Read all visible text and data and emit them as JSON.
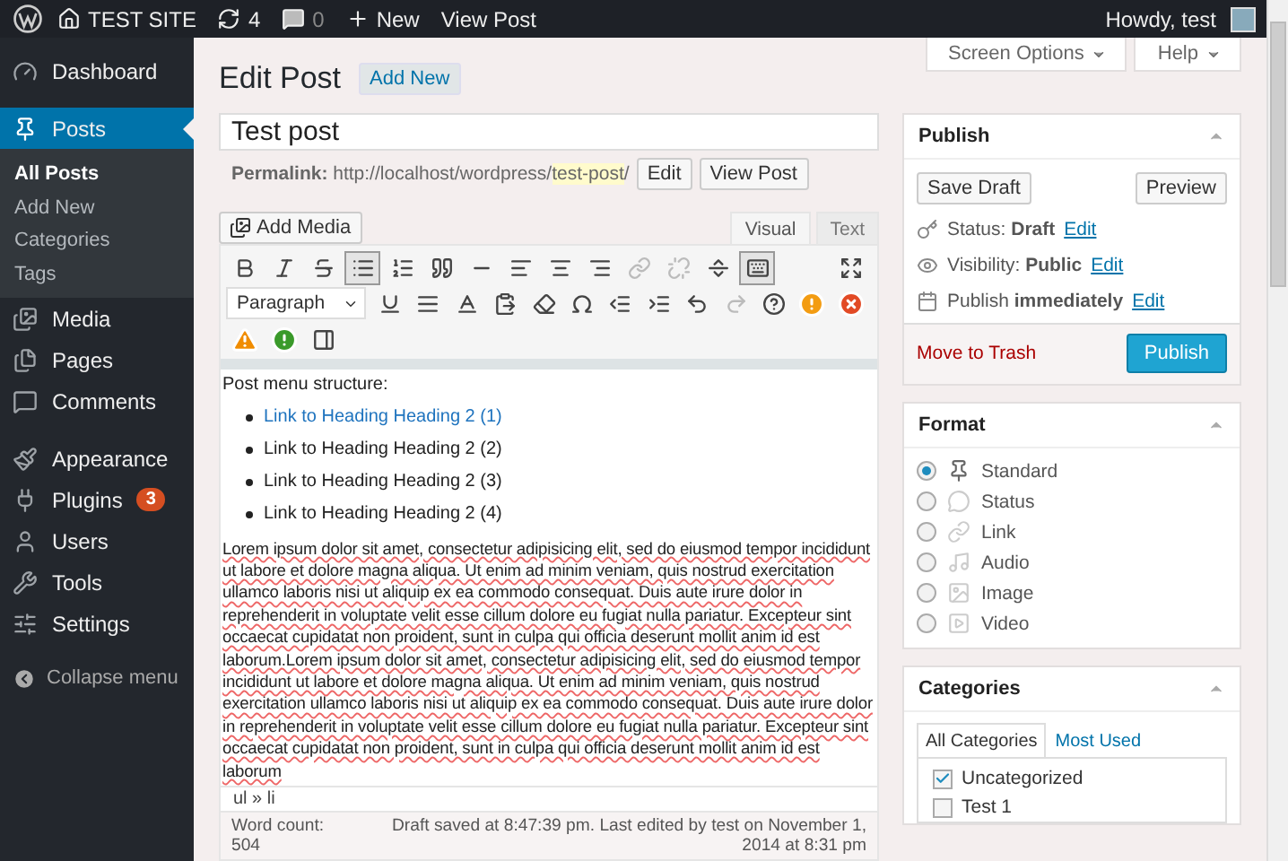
{
  "admin_bar": {
    "site_name": "TEST SITE",
    "updates_count": "4",
    "comments_count": "0",
    "new_label": "New",
    "view_post": "View Post",
    "greeting": "Howdy, test"
  },
  "sidebar": {
    "groups": [
      [
        {
          "kind": "dashboard",
          "label": "Dashboard",
          "selected": false
        }
      ],
      [
        {
          "kind": "posts",
          "label": "Posts",
          "selected": true,
          "expanded": true,
          "children": [
            {
              "label": "All Posts",
              "selected": true
            },
            {
              "label": "Add New",
              "selected": false
            },
            {
              "label": "Categories",
              "selected": false
            },
            {
              "label": "Tags",
              "selected": false
            }
          ]
        },
        {
          "kind": "media",
          "label": "Media",
          "selected": false
        },
        {
          "kind": "pages",
          "label": "Pages",
          "selected": false
        },
        {
          "kind": "comments",
          "label": "Comments",
          "selected": false
        }
      ],
      [
        {
          "kind": "appearance",
          "label": "Appearance",
          "selected": false
        },
        {
          "kind": "plugins",
          "label": "Plugins",
          "selected": false,
          "badge": "3"
        },
        {
          "kind": "users",
          "label": "Users",
          "selected": false
        },
        {
          "kind": "tools",
          "label": "Tools",
          "selected": false
        },
        {
          "kind": "settings",
          "label": "Settings",
          "selected": false
        }
      ]
    ],
    "collapse": "Collapse menu"
  },
  "screen_tabs": [
    "Screen Options",
    "Help"
  ],
  "header": {
    "title": "Edit Post",
    "add_new": "Add New"
  },
  "post": {
    "title": "Test post",
    "permalink_label": "Permalink:",
    "permalink_prefix": "http://localhost/wordpress/",
    "slug": "test-post",
    "permalink_suffix": "/",
    "edit": "Edit",
    "view_post": "View Post"
  },
  "editor": {
    "add_media": "Add Media",
    "tabs": [
      {
        "label": "Visual",
        "selected": true
      },
      {
        "label": "Text",
        "selected": false
      }
    ],
    "toolbar": [
      [
        {
          "kind": "bold",
          "active": false,
          "disabled": false
        },
        {
          "kind": "italic",
          "active": false,
          "disabled": false
        },
        {
          "kind": "strikethrough",
          "active": false,
          "disabled": false
        },
        {
          "kind": "bullet_list",
          "active": true,
          "disabled": false
        },
        {
          "kind": "numbered_list",
          "active": false,
          "disabled": false
        },
        {
          "kind": "blockquote",
          "active": false,
          "disabled": false
        },
        {
          "kind": "horizontal_rule",
          "active": false,
          "disabled": false
        },
        {
          "kind": "align_left",
          "active": false,
          "disabled": false
        },
        {
          "kind": "align_center",
          "active": false,
          "disabled": false
        },
        {
          "kind": "align_right",
          "active": false,
          "disabled": false
        },
        {
          "kind": "link",
          "active": false,
          "disabled": true
        },
        {
          "kind": "unlink",
          "active": false,
          "disabled": true
        },
        {
          "kind": "read_more",
          "active": false,
          "disabled": false
        },
        {
          "kind": "toolbar_toggle",
          "active": true,
          "disabled": false
        },
        {
          "kind": "fullscreen",
          "active": false,
          "disabled": false
        }
      ],
      [
        {
          "kind": "format_select",
          "value": "Paragraph"
        },
        {
          "kind": "underline",
          "active": false,
          "disabled": false
        },
        {
          "kind": "justify",
          "active": false,
          "disabled": false
        },
        {
          "kind": "text_color",
          "active": false,
          "disabled": false
        },
        {
          "kind": "paste_text",
          "active": false,
          "disabled": false
        },
        {
          "kind": "clear_formatting",
          "active": false,
          "disabled": false
        },
        {
          "kind": "special_character",
          "active": false,
          "disabled": false
        },
        {
          "kind": "outdent",
          "active": false,
          "disabled": false
        },
        {
          "kind": "indent",
          "active": false,
          "disabled": false
        },
        {
          "kind": "undo",
          "active": false,
          "disabled": false
        },
        {
          "kind": "redo",
          "active": false,
          "disabled": true
        },
        {
          "kind": "help",
          "active": false,
          "disabled": false
        },
        {
          "kind": "alert_orange",
          "active": false,
          "disabled": false
        },
        {
          "kind": "error_red",
          "active": false,
          "disabled": false
        }
      ],
      [
        {
          "kind": "warning",
          "active": false,
          "disabled": false
        },
        {
          "kind": "alert_green",
          "active": false,
          "disabled": false
        },
        {
          "kind": "column",
          "active": false,
          "disabled": false
        }
      ]
    ],
    "content": {
      "intro": "Post menu structure:",
      "list": [
        {
          "text": "Link to Heading Heading 2 (1)",
          "linked": true
        },
        {
          "text": "Link to Heading Heading 2 (2)",
          "linked": false
        },
        {
          "text": "Link to Heading Heading 2 (3)",
          "linked": false
        },
        {
          "text": "Link to Heading Heading 2 (4)",
          "linked": false
        }
      ],
      "paragraph": "Lorem ipsum dolor sit amet, consectetur adipisicing elit, sed do eiusmod tempor incididunt ut labore et dolore magna aliqua. Ut enim ad minim veniam, quis nostrud exercitation ullamco laboris nisi ut aliquip ex ea commodo consequat. Duis aute irure dolor in reprehenderit in voluptate velit esse cillum dolore eu fugiat nulla pariatur. Excepteur sint occaecat cupidatat non proident, sunt in culpa qui officia deserunt mollit anim id est laborum.Lorem ipsum dolor sit amet, consectetur adipisicing elit, sed do eiusmod tempor incididunt ut labore et dolore magna aliqua. Ut enim ad minim veniam, quis nostrud exercitation ullamco laboris nisi ut aliquip ex ea commodo consequat. Duis aute irure dolor in reprehenderit in voluptate velit esse cillum dolore eu fugiat nulla pariatur. Excepteur sint occaecat cupidatat non proident, sunt in culpa qui officia deserunt mollit anim id est laborum"
    },
    "path": "ul » li",
    "word_count_label": "Word count:",
    "word_count": "504",
    "draft_status": "Draft saved at 8:47:39 pm. Last edited by test on November 1, 2014 at 8:31 pm"
  },
  "publish": {
    "title": "Publish",
    "save_draft": "Save Draft",
    "preview": "Preview",
    "meta": [
      {
        "kind": "status",
        "label": "Status:",
        "value": "Draft",
        "link": "Edit"
      },
      {
        "kind": "visibility",
        "label": "Visibility:",
        "value": "Public",
        "link": "Edit"
      },
      {
        "kind": "schedule",
        "label": "Publish",
        "value": "immediately",
        "link": "Edit"
      }
    ],
    "trash": "Move to Trash",
    "publish": "Publish"
  },
  "format": {
    "title": "Format",
    "options": [
      {
        "kind": "standard",
        "label": "Standard",
        "selected": true
      },
      {
        "kind": "status",
        "label": "Status",
        "selected": false
      },
      {
        "kind": "link",
        "label": "Link",
        "selected": false
      },
      {
        "kind": "audio",
        "label": "Audio",
        "selected": false
      },
      {
        "kind": "image",
        "label": "Image",
        "selected": false
      },
      {
        "kind": "video",
        "label": "Video",
        "selected": false
      }
    ]
  },
  "categories": {
    "title": "Categories",
    "tabs": [
      {
        "label": "All Categories",
        "selected": true
      },
      {
        "label": "Most Used",
        "selected": false
      }
    ],
    "items": [
      {
        "label": "Uncategorized",
        "checked": true
      },
      {
        "label": "Test 1",
        "checked": false
      }
    ]
  }
}
